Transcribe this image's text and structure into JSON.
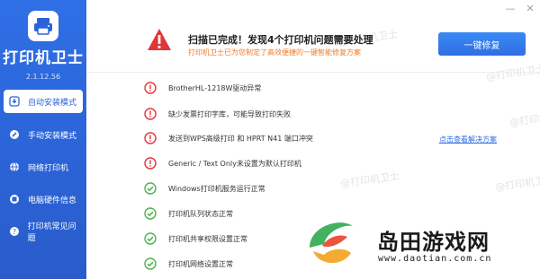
{
  "app": {
    "brand": "打印机卫士",
    "version": "2.1.12.56"
  },
  "sidebar": {
    "items": [
      {
        "label": "自动安装模式",
        "icon": "download-icon",
        "active": true
      },
      {
        "label": "手动安装模式",
        "icon": "wrench-icon",
        "active": false
      },
      {
        "label": "网络打印机",
        "icon": "globe-icon",
        "active": false
      },
      {
        "label": "电脑硬件信息",
        "icon": "hardware-icon",
        "active": false
      },
      {
        "label": "打印机常见问题",
        "icon": "help-icon",
        "active": false
      }
    ]
  },
  "header": {
    "headline": "扫描已完成！发现4个打印机问题需要处理",
    "subline": "打印机卫士已为您制定了高效便捷的一键智能修复方案",
    "fix_button": "一键修复"
  },
  "issues": [
    {
      "text": "BrotherHL-1218W驱动异常",
      "status": "error"
    },
    {
      "text": "缺少发票打印字库，可能导致打印失败",
      "status": "error"
    },
    {
      "text": "发送到WPS高级打印 和 HPRT N41 端口冲突",
      "status": "error"
    },
    {
      "text": "Generic / Text Only未设置为默认打印机",
      "status": "error"
    },
    {
      "text": "Windows打印机服务运行正常",
      "status": "ok"
    },
    {
      "text": "打印机队列状态正常",
      "status": "ok"
    },
    {
      "text": "打印机共享权限设置正常",
      "status": "ok"
    },
    {
      "text": "打印机网络设置正常",
      "status": "ok"
    }
  ],
  "link": "点击查看解决方案",
  "watermark": "@打印机卫士",
  "overlay": {
    "title": "岛田游戏网",
    "url": "www.daotian.com.cn"
  },
  "colors": {
    "sidebar": "#2b64d8",
    "error": "#e0353b",
    "ok": "#4cb24c",
    "accent": "#2f6ee3",
    "subline": "#f07a2a"
  },
  "window": {
    "minimize": "—",
    "close": "✕"
  }
}
